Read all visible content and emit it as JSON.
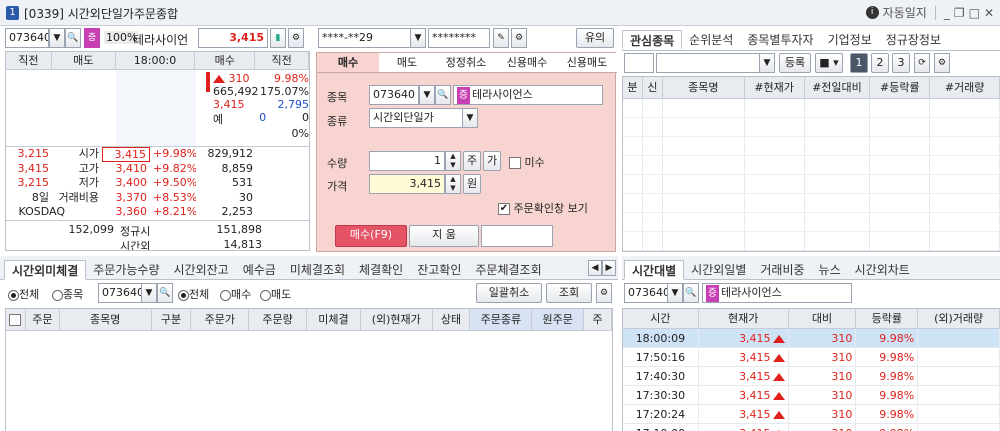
{
  "window": {
    "number": "1",
    "title": "[0339] 시간외단일가주문종합",
    "autolock_label": "자동일지"
  },
  "left": {
    "code": "073640",
    "badge": "증",
    "margin": "100%",
    "name": "테라사이언",
    "price": "3,415",
    "hoga_headers": [
      "직전",
      "매도",
      "18:00:0",
      "매수",
      "직전"
    ],
    "right_info": [
      {
        "a": "310",
        "b": "9.98%"
      },
      {
        "a": "665,492",
        "b": "175.07%"
      },
      {
        "a": "3,415",
        "b": "2,795"
      },
      {
        "a": "예",
        "b": "0",
        "c": "0"
      },
      {
        "a": "0%"
      }
    ],
    "buy_qty_row": {
      "a": "3,215",
      "b": "시가",
      "c": "3,415",
      "d": "+9.98%",
      "e": "829,912"
    },
    "stats": [
      {
        "prev": "3,215",
        "label": "시가",
        "val": "3,415",
        "pct": "+9.98%",
        "vol": "829,912"
      },
      {
        "prev": "3,415",
        "label": "고가",
        "val": "3,410",
        "pct": "+9.82%",
        "vol": "8,859"
      },
      {
        "prev": "3,215",
        "label": "저가",
        "val": "3,400",
        "pct": "+9.50%",
        "vol": "531"
      },
      {
        "prev": "8일",
        "label": "거래비용",
        "val": "3,370",
        "pct": "+8.53%",
        "vol": "30"
      },
      {
        "prev": "KOSDAQ",
        "label": "",
        "val": "3,360",
        "pct": "+8.21%",
        "vol": "2,253"
      }
    ],
    "bottom": {
      "sell_total": "152,099",
      "regular_label": "정규시",
      "regular_val": "151,898",
      "after_label": "시간외",
      "after_val": "14,813"
    }
  },
  "order": {
    "account": "****-**29",
    "password": "********",
    "caution_label": "유의",
    "tabs": [
      "매수",
      "매도",
      "정정취소",
      "신용매수",
      "신용매도"
    ],
    "code_label": "종목",
    "code": "073640",
    "badge": "증",
    "name": "테라사이언스",
    "type_label": "종류",
    "type_value": "시간외단일가",
    "qty_label": "수량",
    "qty_value": "1",
    "qty_unit": "주",
    "qty_btn": "가",
    "unfilled_label": "미수",
    "price_label": "가격",
    "price_value": "3,415",
    "price_unit": "원",
    "confirm_label": "주문확인창 보기",
    "buy_button": "매수(F9)",
    "clear_button": "지  움"
  },
  "watch": {
    "tabs": [
      "관심종목",
      "순위분석",
      "종목별투자자",
      "기업정보",
      "정규장정보"
    ],
    "register_label": "등록",
    "pages": [
      "1",
      "2",
      "3"
    ],
    "headers": [
      "분",
      "신",
      "종목명",
      "#현재가",
      "#전일대비",
      "#등락률",
      "#거래량"
    ]
  },
  "unfilled": {
    "tabs": [
      "시간외미체결",
      "주문가능수량",
      "시간외잔고",
      "예수금",
      "미체결조회",
      "체결확인",
      "잔고확인",
      "주문체결조회"
    ],
    "radio1": [
      "전체",
      "종목"
    ],
    "code": "073640",
    "radio2": [
      "전체",
      "매수",
      "매도"
    ],
    "bulk_cancel": "일괄취소",
    "inquiry": "조회",
    "headers": [
      "주문",
      "종목명",
      "구분",
      "주문가",
      "주문량",
      "미체결",
      "(외)현재가",
      "상태",
      "주문종류",
      "원주문",
      "주"
    ]
  },
  "timeline": {
    "tabs": [
      "시간대별",
      "시간외일별",
      "거래비중",
      "뉴스",
      "시간외차트"
    ],
    "code": "073640",
    "badge": "증",
    "name": "테라사이언스",
    "headers": [
      "시간",
      "현재가",
      "대비",
      "등락률",
      "(외)거래량"
    ],
    "rows": [
      {
        "time": "18:00:09",
        "price": "3,415",
        "diff": "310",
        "rate": "9.98%"
      },
      {
        "time": "17:50:16",
        "price": "3,415",
        "diff": "310",
        "rate": "9.98%"
      },
      {
        "time": "17:40:30",
        "price": "3,415",
        "diff": "310",
        "rate": "9.98%"
      },
      {
        "time": "17:30:30",
        "price": "3,415",
        "diff": "310",
        "rate": "9.98%"
      },
      {
        "time": "17:20:24",
        "price": "3,415",
        "diff": "310",
        "rate": "9.98%"
      },
      {
        "time": "17:10:00",
        "price": "3,415",
        "diff": "310",
        "rate": "9.98%"
      }
    ]
  }
}
